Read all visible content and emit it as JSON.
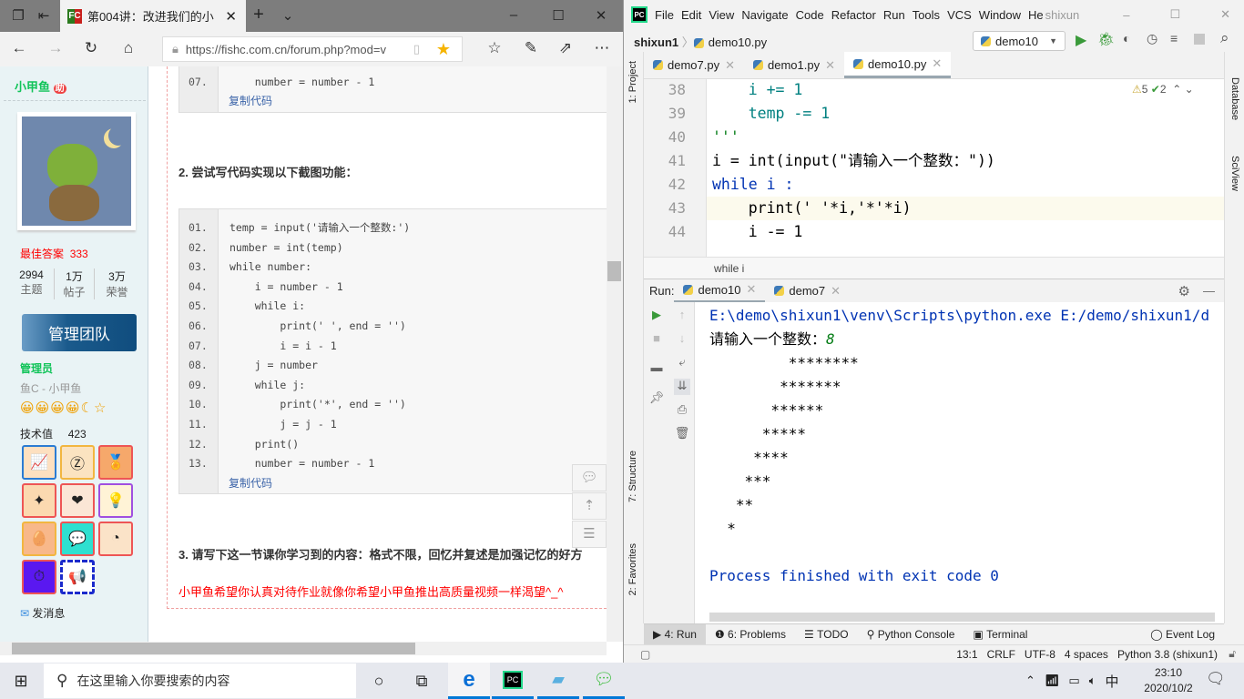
{
  "browser": {
    "tab_title": "第004讲：改进我们的小",
    "favicon_text": "FC",
    "url": "https://fishc.com.cn/forum.php?mod=v",
    "sidebar": {
      "username": "小甲鱼",
      "user_badge": "助",
      "best_answer_label": "最佳答案",
      "best_answer_value": "333",
      "stats": [
        {
          "value": "2994",
          "label": "主题"
        },
        {
          "value": "1万",
          "label": "帖子"
        },
        {
          "value": "3万",
          "label": "荣誉"
        }
      ],
      "team_badge": "管理团队",
      "role": "管理员",
      "title": "鱼C - 小甲鱼",
      "skill_label": "技术值",
      "skill_value": "423",
      "send_message": "发消息"
    },
    "post": {
      "code1": [
        {
          "n": "07.",
          "code": "    number = number - 1"
        }
      ],
      "copy_code": "复制代码",
      "heading2": "2. 尝试写代码实现以下截图功能：",
      "code2": [
        {
          "n": "01.",
          "code": "temp = input('请输入一个整数:')"
        },
        {
          "n": "02.",
          "code": "number = int(temp)"
        },
        {
          "n": "03.",
          "code": "while number:"
        },
        {
          "n": "04.",
          "code": "    i = number - 1"
        },
        {
          "n": "05.",
          "code": "    while i:"
        },
        {
          "n": "06.",
          "code": "        print(' ', end = '')"
        },
        {
          "n": "07.",
          "code": "        i = i - 1"
        },
        {
          "n": "08.",
          "code": "    j = number"
        },
        {
          "n": "09.",
          "code": "    while j:"
        },
        {
          "n": "10.",
          "code": "        print('*', end = '')"
        },
        {
          "n": "11.",
          "code": "        j = j - 1"
        },
        {
          "n": "12.",
          "code": "    print()"
        },
        {
          "n": "13.",
          "code": "    number = number - 1"
        }
      ],
      "heading3": "3. 请写下这一节课你学习到的内容：格式不限，回忆并复述是加强记忆的好方",
      "red_note": "小甲鱼希望你认真对待作业就像你希望小甲鱼推出高质量视频一样渴望^_^"
    }
  },
  "ide": {
    "menu": [
      "File",
      "Edit",
      "View",
      "Navigate",
      "Code",
      "Refactor",
      "Run",
      "Tools",
      "VCS",
      "Window",
      "He"
    ],
    "window_title": "shixun",
    "breadcrumb": {
      "project": "shixun1",
      "file": "demo10.py"
    },
    "run_config": "demo10",
    "tabs": [
      {
        "label": "demo7.py"
      },
      {
        "label": "demo1.py"
      },
      {
        "label": "demo10.py",
        "active": true
      }
    ],
    "left_tools": [
      "1: Project",
      "7: Structure",
      "2: Favorites"
    ],
    "right_tools": [
      "Database",
      "SciView"
    ],
    "inspections": {
      "warnings": "5",
      "ok": "2"
    },
    "editor_lines": [
      {
        "n": "38",
        "code": "    i += 1"
      },
      {
        "n": "39",
        "code": "    temp -= 1"
      },
      {
        "n": "40",
        "code": "'''"
      },
      {
        "n": "41",
        "code": "i = int(input(\"请输入一个整数：\"))"
      },
      {
        "n": "42",
        "code": "while i :"
      },
      {
        "n": "43",
        "code": "    print(' '*i,'*'*i)"
      },
      {
        "n": "44",
        "code": "    i -= 1"
      }
    ],
    "code_breadcrumb": "while i",
    "run_label": "Run:",
    "run_tabs": [
      "demo10",
      "demo7"
    ],
    "console": {
      "command": "E:\\demo\\shixun1\\venv\\Scripts\\python.exe E:/demo/shixun1/d",
      "prompt": "请输入一个整数：",
      "input": "8",
      "output": [
        "         ********",
        "        *******",
        "       ******",
        "      *****",
        "     ****",
        "    ***",
        "   **",
        "  *"
      ],
      "finished": "Process finished with exit code 0"
    },
    "bottom_tabs": [
      "4: Run",
      "6: Problems",
      "TODO",
      "Python Console",
      "Terminal"
    ],
    "event_log": "Event Log",
    "status": {
      "position": "13:1",
      "line_sep": "CRLF",
      "encoding": "UTF-8",
      "indent": "4 spaces",
      "interpreter": "Python 3.8 (shixun1)"
    }
  },
  "taskbar": {
    "search_placeholder": "在这里输入你要搜索的内容",
    "ime": "中",
    "time": "23:10",
    "date": "2020/10/2"
  }
}
